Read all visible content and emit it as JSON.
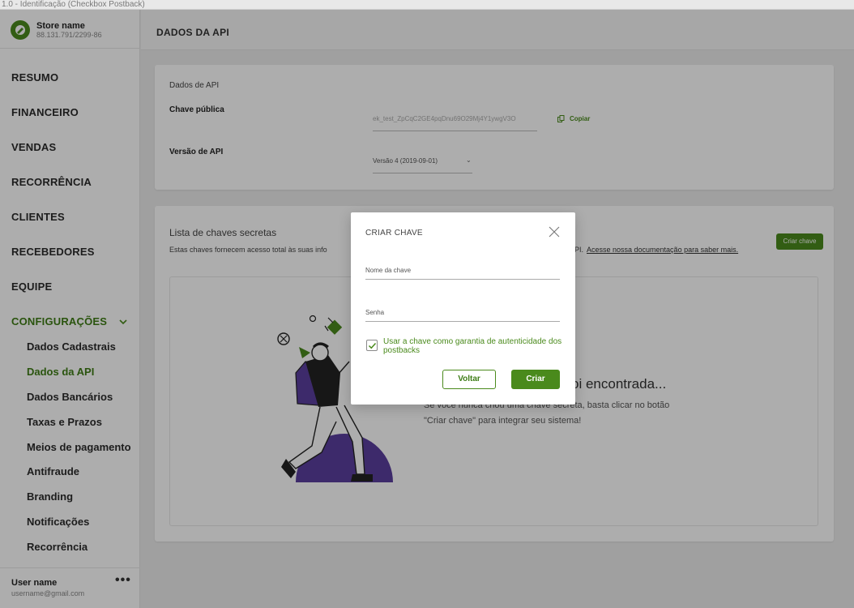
{
  "window": {
    "title": "1.0 - Identificação (Checkbox Postback)"
  },
  "store": {
    "name": "Store name",
    "id": "88.131.791/2299-86"
  },
  "menu": {
    "resumo": "RESUMO",
    "financeiro": "FINANCEIRO",
    "vendas": "VENDAS",
    "recorrencia": "RECORRÊNCIA",
    "clientes": "CLIENTES",
    "recebedores": "RECEBEDORES",
    "equipe": "EQUIPE",
    "configuracoes": "CONFIGURAÇÕES"
  },
  "submenu": [
    "Dados Cadastrais",
    "Dados da API",
    "Dados Bancários",
    "Taxas e Prazos",
    "Meios de pagamento",
    "Antifraude",
    "Branding",
    "Notificações",
    "Recorrência"
  ],
  "user": {
    "name": "User name",
    "email": "username@gmail.com",
    "more": "•••"
  },
  "page": {
    "title": "DADOS DA API"
  },
  "api_card": {
    "section": "Dados de API",
    "public_key_label": "Chave pública",
    "public_key_value": "ek_test_ZpCqC2GE4pqDnu69O29Mj4Y1ywgV3O",
    "copy_label": "Copiar",
    "version_label": "Versão de API",
    "version_value": "Versão 4 (2019-09-01)"
  },
  "secret_card": {
    "title": "Lista de chaves secretas",
    "desc_left": "Estas chaves fornecem acesso total às suas info",
    "desc_right": "PI.",
    "doc_link": "Acesse nossa documentação para saber mais.",
    "create_button": "Criar chave",
    "empty_title": "oi encontrada...",
    "empty_line1": "Se você nunca criou uma chave secreta, basta clicar no botão",
    "empty_line2": "\"Criar chave\" para integrar seu sistema!"
  },
  "modal": {
    "title": "CRIAR CHAVE",
    "name_placeholder": "Nome da chave",
    "password_placeholder": "Senha",
    "checkbox_label": "Usar a chave como garantia de autenticidade dos postbacks",
    "checkbox_checked": true,
    "back_button": "Voltar",
    "create_button": "Criar"
  },
  "colors": {
    "accent": "#4a8a1c",
    "illustration_purple": "#5b3f9e"
  }
}
